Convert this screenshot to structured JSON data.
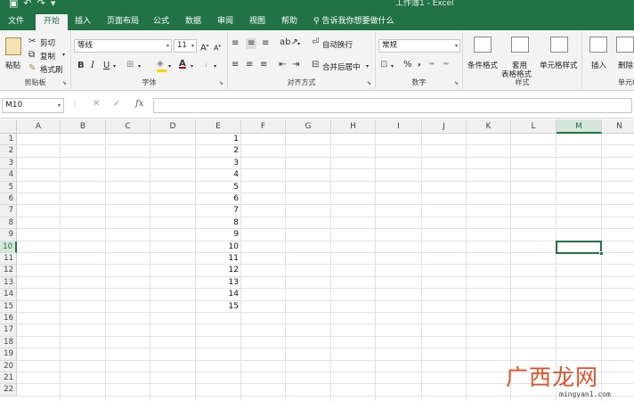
{
  "title_bar": {
    "window_title": "工作簿1 - Excel",
    "quick_access": [
      "save-icon",
      "undo-icon",
      "redo-icon",
      "customize-icon"
    ]
  },
  "tabs": [
    {
      "id": "file",
      "label": "文件"
    },
    {
      "id": "home",
      "label": "开始",
      "active": true
    },
    {
      "id": "insert",
      "label": "插入"
    },
    {
      "id": "layout",
      "label": "页面布局"
    },
    {
      "id": "formulas",
      "label": "公式"
    },
    {
      "id": "data",
      "label": "数据"
    },
    {
      "id": "review",
      "label": "审阅"
    },
    {
      "id": "view",
      "label": "视图"
    },
    {
      "id": "help",
      "label": "帮助"
    }
  ],
  "tell_me": {
    "icon": "lightbulb-search-icon",
    "label": "告诉我你想要做什么"
  },
  "ribbon": {
    "clipboard": {
      "group_label": "剪贴板",
      "paste": "粘贴",
      "cut": "剪切",
      "copy": "复制",
      "format_painter": "格式刷"
    },
    "font": {
      "group_label": "字体",
      "font_name": "等线",
      "font_size": "11",
      "bold": "B",
      "italic": "I",
      "underline": "U",
      "grow": "A",
      "shrink": "A"
    },
    "alignment": {
      "group_label": "对齐方式",
      "wrap_text": "自动换行",
      "merge_center": "合并后居中"
    },
    "number": {
      "group_label": "数字",
      "format": "常规",
      "percent": "%",
      "comma": ","
    },
    "styles": {
      "group_label": "样式",
      "conditional": "条件格式",
      "table_1": "套用",
      "table_2": "表格格式",
      "cell_styles": "单元格样式"
    },
    "cells": {
      "group_label": "单元格",
      "insert": "插入",
      "delete": "删除"
    }
  },
  "formula_bar": {
    "name_box": "M10",
    "cancel": "✕",
    "enter": "✓",
    "fx": "fx",
    "value": ""
  },
  "columns": [
    "A",
    "B",
    "C",
    "D",
    "E",
    "F",
    "G",
    "H",
    "I",
    "J",
    "K",
    "L",
    "M",
    "N"
  ],
  "selected_column": "M",
  "rows": [
    "1",
    "2",
    "3",
    "4",
    "5",
    "6",
    "7",
    "8",
    "9",
    "10",
    "11",
    "12",
    "13",
    "14",
    "15",
    "16",
    "17",
    "18",
    "19",
    "20",
    "21",
    "22"
  ],
  "selected_row": "10",
  "active_cell": "M10",
  "cells_E": [
    "1",
    "2",
    "3",
    "4",
    "5",
    "6",
    "7",
    "8",
    "9",
    "10",
    "11",
    "12",
    "13",
    "14",
    "15"
  ],
  "watermark": {
    "text": "广西龙网",
    "url": "mingyan1.com"
  },
  "colors": {
    "excel_green": "#217346",
    "ribbon_bg": "#f3f3f3",
    "header_bg": "#f0f0f0",
    "font_color_red": "#c00000",
    "fill_yellow": "#ffd400"
  }
}
